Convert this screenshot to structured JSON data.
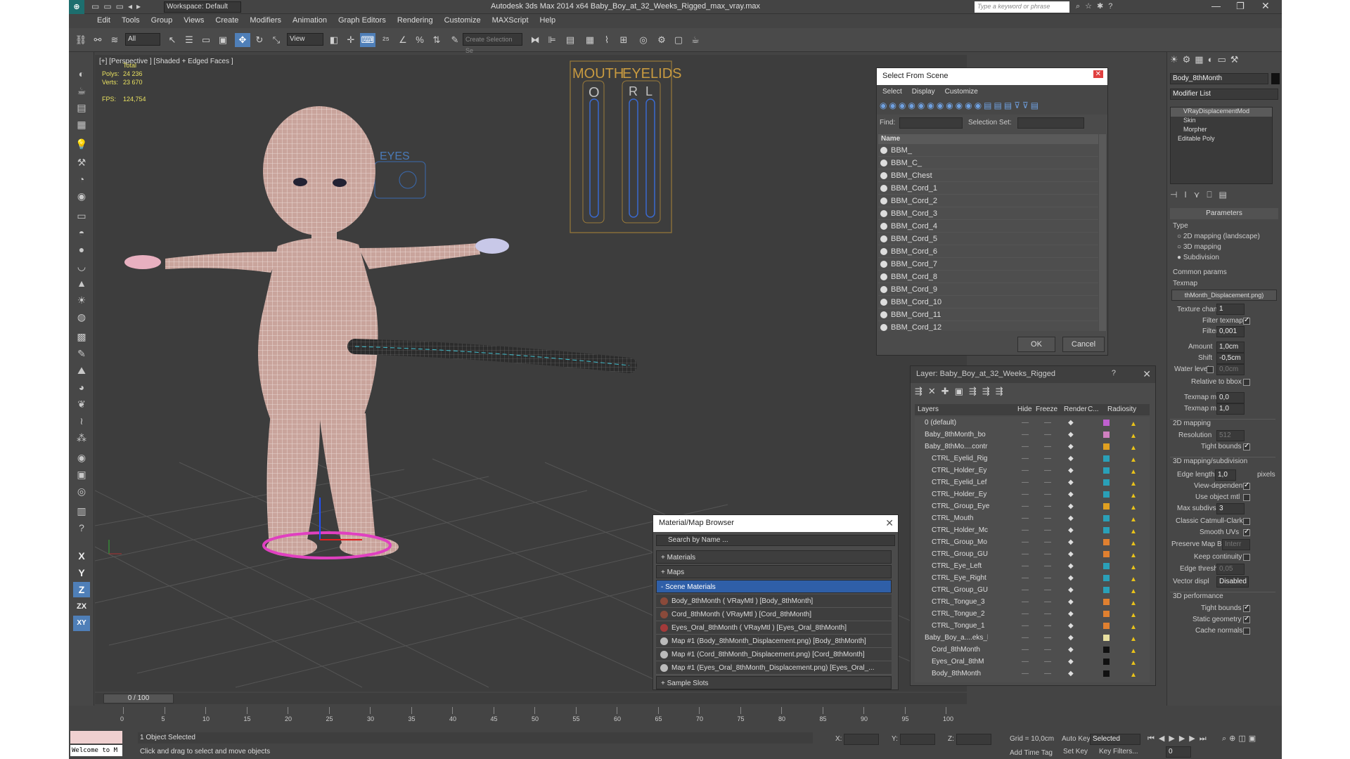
{
  "window": {
    "title": "Autodesk 3ds Max  2014 x64     Baby_Boy_at_32_Weeks_Rigged_max_vray.max",
    "workspace": "Workspace: Default",
    "search_placeholder": "Type a keyword or phrase"
  },
  "menu": [
    "Edit",
    "Tools",
    "Group",
    "Views",
    "Create",
    "Modifiers",
    "Animation",
    "Graph Editors",
    "Rendering",
    "Customize",
    "MAXScript",
    "Help"
  ],
  "toolbar": {
    "filter": "All",
    "ref_coord": "View",
    "selection_set_placeholder": "Create Selection Se"
  },
  "viewport": {
    "label": "[+] [Perspective ] [Shaded + Edged Faces ]",
    "stats": {
      "header": "Total",
      "polys_label": "Polys:",
      "polys": "24 236",
      "verts_label": "Verts:",
      "verts": "23 670",
      "fps_label": "FPS:",
      "fps": "124,754"
    },
    "labels": {
      "eyes": "EYES",
      "mouth": "MOUTH",
      "eyelids": "EYELIDS",
      "o": "O",
      "r": "R",
      "l": "L"
    }
  },
  "select_from_scene": {
    "title": "Select From Scene",
    "tabs": [
      "Select",
      "Display",
      "Customize"
    ],
    "find_label": "Find:",
    "selection_set_label": "Selection Set:",
    "column": "Name",
    "items": [
      "BBM_",
      "BBM_C_",
      "BBM_Chest",
      "BBM_Cord_1",
      "BBM_Cord_2",
      "BBM_Cord_3",
      "BBM_Cord_4",
      "BBM_Cord_5",
      "BBM_Cord_6",
      "BBM_Cord_7",
      "BBM_Cord_8",
      "BBM_Cord_9",
      "BBM_Cord_10",
      "BBM_Cord_11",
      "BBM_Cord_12"
    ],
    "ok": "OK",
    "cancel": "Cancel"
  },
  "layer_dialog": {
    "title": "Layer: Baby_Boy_at_32_Weeks_Rigged",
    "help": "?",
    "columns": [
      "Layers",
      "Hide",
      "Freeze",
      "Render",
      "C...",
      "Radiosity"
    ],
    "rows": [
      {
        "name": "0 (default)",
        "color": "#c060d0",
        "indent": 0
      },
      {
        "name": "Baby_8thMonth_bo",
        "color": "#d080c0",
        "indent": 0
      },
      {
        "name": "Baby_8thMo....contr",
        "color": "#e0a020",
        "indent": 0
      },
      {
        "name": "CTRL_Eyelid_Rig",
        "color": "#2aa0b8",
        "indent": 1
      },
      {
        "name": "CTRL_Holder_Ey",
        "color": "#2aa0b8",
        "indent": 1
      },
      {
        "name": "CTRL_Eyelid_Lef",
        "color": "#2aa0b8",
        "indent": 1
      },
      {
        "name": "CTRL_Holder_Ey",
        "color": "#2aa0b8",
        "indent": 1
      },
      {
        "name": "CTRL_Group_Eye",
        "color": "#e0a020",
        "indent": 1
      },
      {
        "name": "CTRL_Mouth",
        "color": "#2aa0b8",
        "indent": 1
      },
      {
        "name": "CTRL_Holder_Mc",
        "color": "#2aa0b8",
        "indent": 1
      },
      {
        "name": "CTRL_Group_Mo",
        "color": "#e08030",
        "indent": 1
      },
      {
        "name": "CTRL_Group_GU",
        "color": "#e08030",
        "indent": 1
      },
      {
        "name": "CTRL_Eye_Left",
        "color": "#2aa0b8",
        "indent": 1
      },
      {
        "name": "CTRL_Eye_Right",
        "color": "#2aa0b8",
        "indent": 1
      },
      {
        "name": "CTRL_Group_GU",
        "color": "#2aa0b8",
        "indent": 1
      },
      {
        "name": "CTRL_Tongue_3",
        "color": "#e08030",
        "indent": 1
      },
      {
        "name": "CTRL_Tongue_2",
        "color": "#e08030",
        "indent": 1
      },
      {
        "name": "CTRL_Tongue_1",
        "color": "#e08030",
        "indent": 1
      },
      {
        "name": "Baby_Boy_a....eks_l",
        "color": "#e8e0a0",
        "indent": 0
      },
      {
        "name": "Cord_8thMonth",
        "color": "#111111",
        "indent": 1
      },
      {
        "name": "Eyes_Oral_8thM",
        "color": "#111111",
        "indent": 1
      },
      {
        "name": "Body_8thMonth",
        "color": "#111111",
        "indent": 1
      }
    ]
  },
  "material_browser": {
    "title": "Material/Map Browser",
    "search": "Search by Name ...",
    "groups": [
      "+ Materials",
      "+ Maps",
      "- Scene Materials"
    ],
    "items": [
      {
        "name": "Body_8thMonth  ( VRayMtl ) [Body_8thMonth]",
        "swatch": "#8a4a3a"
      },
      {
        "name": "Cord_8thMonth  ( VRayMtl ) [Cord_8thMonth]",
        "swatch": "#8a4a3a"
      },
      {
        "name": "Eyes_Oral_8thMonth  ( VRayMtl ) [Eyes_Oral_8thMonth]",
        "swatch": "#a33a3a"
      },
      {
        "name": "Map #1 (Body_8thMonth_Displacement.png) [Body_8thMonth]",
        "swatch": "#bbbbbb"
      },
      {
        "name": "Map #1 (Cord_8thMonth_Displacement.png) [Cord_8thMonth]",
        "swatch": "#bbbbbb"
      },
      {
        "name": "Map #1 (Eyes_Oral_8thMonth_Displacement.png) [Eyes_Oral_...",
        "swatch": "#bbbbbb"
      }
    ],
    "sample_slots": "+ Sample Slots"
  },
  "command_panel": {
    "object_name": "Body_8thMonth",
    "modifier_list": "Modifier List",
    "stack": [
      "VRayDisplacementMod",
      "Skin",
      "Morpher",
      "Editable Poly"
    ],
    "parameters": {
      "title": "Parameters",
      "type_label": "Type",
      "types": [
        "2D mapping (landscape)",
        "3D mapping",
        "Subdivision"
      ],
      "common": "Common params",
      "texmap_label": "Texmap",
      "texmap": "thMonth_Displacement.png)",
      "texture_chan_label": "Texture chan",
      "texture_chan": "1",
      "filter_texmap": "Filter texmap",
      "filter_blur_label": "Filter blur",
      "filter_blur": "0,001",
      "amount_label": "Amount",
      "amount": "1,0cm",
      "shift_label": "Shift",
      "shift": "-0,5cm",
      "water_label": "Water level",
      "water": "0,0cm",
      "relative": "Relative to bbox",
      "texmap_min_label": "Texmap min",
      "texmap_min": "0,0",
      "texmap_max_label": "Texmap max",
      "texmap_max": "1,0",
      "map2d": "2D mapping",
      "resolution_label": "Resolution",
      "resolution": "512",
      "tight": "Tight bounds",
      "map3d": "3D mapping/subdivision",
      "edge_label": "Edge length",
      "edge": "1,0",
      "pixels": "pixels",
      "view_dep": "View-dependent",
      "use_obj": "Use object mtl",
      "max_subdivs_label": "Max subdivs",
      "max_subdivs": "3",
      "catmull": "Classic Catmull-Clark",
      "smooth_uvs": "Smooth UVs",
      "preserve_label": "Preserve Map Bnd",
      "preserve": "Interr",
      "keep": "Keep continuity",
      "edge_thresh_label": "Edge thresh",
      "edge_thresh": "0,05",
      "vector_label": "Vector displ",
      "vector": "Disabled",
      "perf": "3D performance",
      "tight2": "Tight bounds",
      "static": "Static geometry",
      "cache": "Cache normals"
    }
  },
  "timeline": {
    "frame": "0 / 100",
    "ticks": [
      "0",
      "5",
      "10",
      "15",
      "20",
      "25",
      "30",
      "35",
      "40",
      "45",
      "50",
      "55",
      "60",
      "65",
      "70",
      "75",
      "80",
      "85",
      "90",
      "95",
      "100"
    ]
  },
  "status": {
    "maxscript": "Welcome to M",
    "selected": "1 Object Selected",
    "prompt": "Click and drag to select and move objects",
    "x_label": "X:",
    "y_label": "Y:",
    "z_label": "Z:",
    "grid": "Grid = 10,0cm",
    "add_time_tag": "Add Time Tag",
    "auto_key": "Auto Key",
    "set_key": "Set Key",
    "key_mode": "Selected",
    "key_filters": "Key Filters...",
    "frame": "0"
  },
  "colors": {
    "accent": "#4f7fb8",
    "skin_wire": "#e8d0cc",
    "cord": "#2a2a2a",
    "controller": "#d0a040"
  }
}
